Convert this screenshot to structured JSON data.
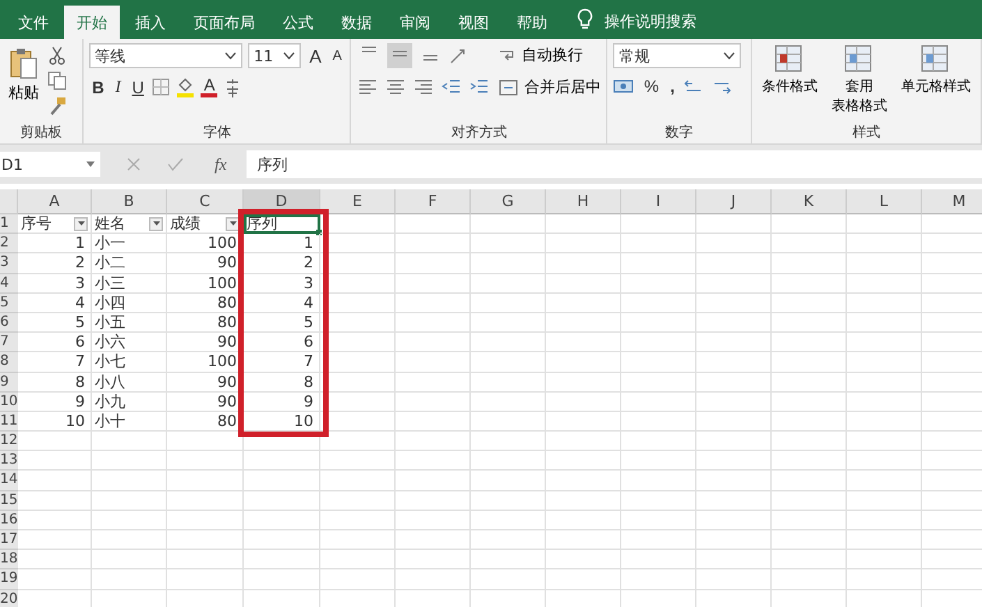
{
  "ribbon_tabs": [
    {
      "label": "文件",
      "selected": false
    },
    {
      "label": "开始",
      "selected": true
    },
    {
      "label": "插入",
      "selected": false
    },
    {
      "label": "页面布局",
      "selected": false
    },
    {
      "label": "公式",
      "selected": false
    },
    {
      "label": "数据",
      "selected": false
    },
    {
      "label": "审阅",
      "selected": false
    },
    {
      "label": "视图",
      "selected": false
    },
    {
      "label": "帮助",
      "selected": false
    }
  ],
  "tell_me": "操作说明搜索",
  "ribbon": {
    "clipboard": {
      "label": "剪贴板",
      "paste": "粘贴"
    },
    "font": {
      "label": "字体",
      "font_name": "等线",
      "font_size": "11",
      "grow": "A",
      "shrink": "A",
      "bold": "B",
      "italic": "I",
      "underline": "U",
      "font_color": "A"
    },
    "alignment": {
      "label": "对齐方式",
      "vertical": [
        {
          "kind": "top",
          "selected": false
        },
        {
          "kind": "middle",
          "selected": true
        },
        {
          "kind": "bottom",
          "selected": false
        }
      ],
      "wrap_text": "自动换行",
      "merge_center": "合并后居中"
    },
    "number": {
      "label": "数字",
      "format": "常规",
      "percent": "%",
      "comma": ","
    },
    "styles": {
      "label": "样式",
      "buttons": [
        {
          "lines": [
            "条件格式"
          ]
        },
        {
          "lines": [
            "套用",
            "表格格式"
          ]
        },
        {
          "lines": [
            "单元格样式"
          ]
        }
      ]
    }
  },
  "formula_bar": {
    "name_box": "D1",
    "fx": "fx",
    "value": "序列"
  },
  "sheet": {
    "columns": [
      {
        "label": "A",
        "kind": "number",
        "selected": false,
        "highlighted": false
      },
      {
        "label": "B",
        "kind": "text",
        "selected": false,
        "highlighted": false
      },
      {
        "label": "C",
        "kind": "number",
        "selected": false,
        "highlighted": false
      },
      {
        "label": "D",
        "kind": "number",
        "selected": true,
        "highlighted": true
      },
      {
        "label": "E",
        "selected": false,
        "highlighted": false
      },
      {
        "label": "F",
        "selected": false,
        "highlighted": false
      },
      {
        "label": "G",
        "selected": false,
        "highlighted": false
      },
      {
        "label": "H",
        "selected": false,
        "highlighted": false
      },
      {
        "label": "I",
        "selected": false,
        "highlighted": false
      },
      {
        "label": "J",
        "selected": false,
        "highlighted": false
      },
      {
        "label": "K",
        "selected": false,
        "highlighted": false
      },
      {
        "label": "L",
        "selected": false,
        "highlighted": false
      },
      {
        "label": "M",
        "selected": false,
        "highlighted": false
      }
    ],
    "row_numbers": [
      "1",
      "2",
      "3",
      "4",
      "5",
      "6",
      "7",
      "8",
      "9",
      "10",
      "11",
      "12",
      "13",
      "14",
      "15",
      "16",
      "17",
      "18",
      "19",
      "20"
    ],
    "header_row": [
      {
        "text": "序号",
        "filter": true,
        "selected": false
      },
      {
        "text": "姓名",
        "filter": true,
        "selected": false
      },
      {
        "text": "成绩",
        "filter": true,
        "selected": false
      },
      {
        "text": "序列",
        "filter": false,
        "selected": true
      }
    ],
    "rows": [
      [
        "1",
        "小一",
        "100",
        "1"
      ],
      [
        "2",
        "小二",
        "90",
        "2"
      ],
      [
        "3",
        "小三",
        "100",
        "3"
      ],
      [
        "4",
        "小四",
        "80",
        "4"
      ],
      [
        "5",
        "小五",
        "80",
        "5"
      ],
      [
        "6",
        "小六",
        "90",
        "6"
      ],
      [
        "7",
        "小七",
        "100",
        "7"
      ],
      [
        "8",
        "小八",
        "90",
        "8"
      ],
      [
        "9",
        "小九",
        "90",
        "9"
      ],
      [
        "10",
        "小十",
        "80",
        "10"
      ]
    ]
  }
}
